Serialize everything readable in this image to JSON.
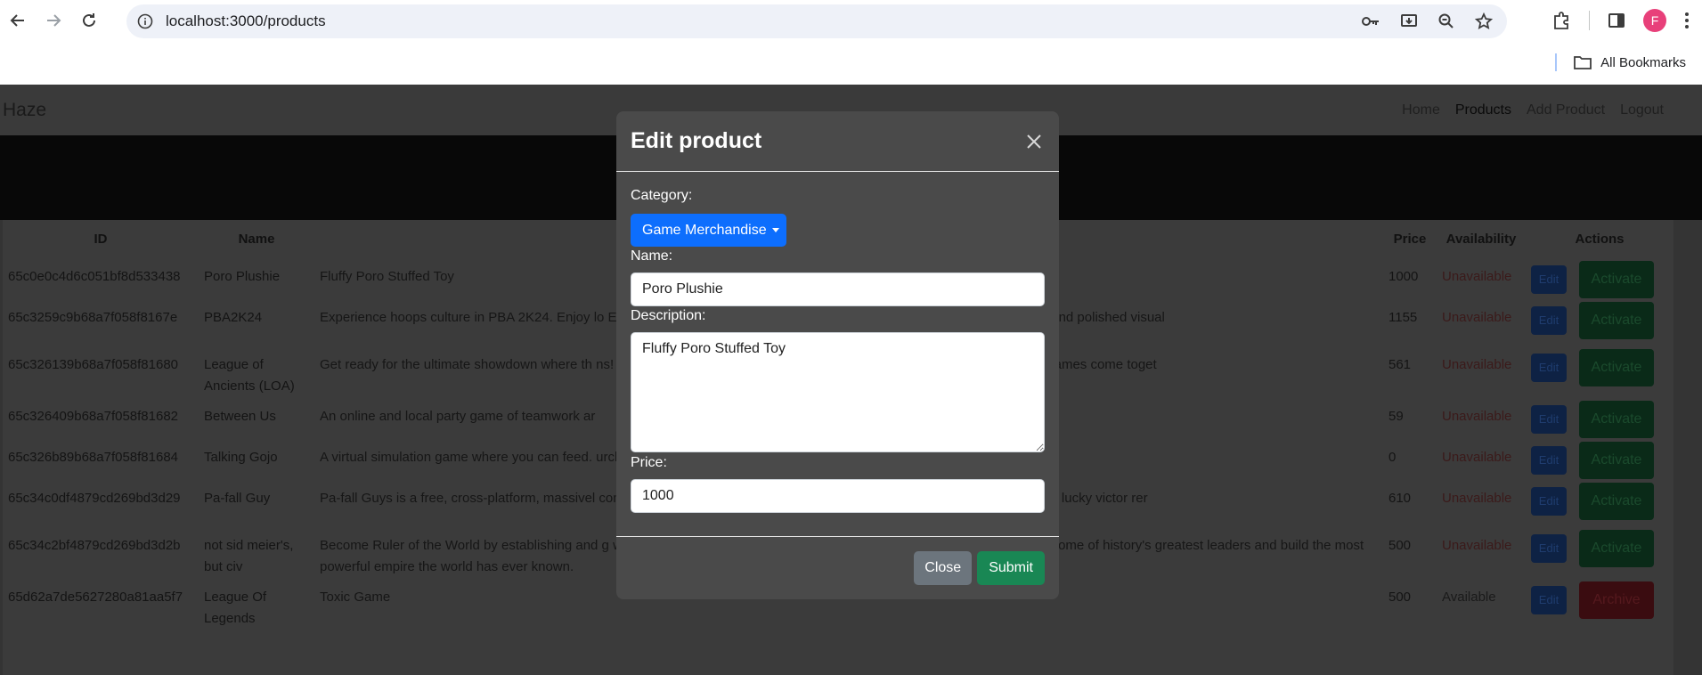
{
  "browser": {
    "url": "localhost:3000/products",
    "avatar_letter": "F",
    "bookmarks_label": "All Bookmarks"
  },
  "app": {
    "brand": "Haze",
    "nav": [
      "Home",
      "Products",
      "Add Product",
      "Logout"
    ],
    "active_nav": "Products"
  },
  "table": {
    "headers": [
      "ID",
      "Name",
      "",
      "Price",
      "Availability",
      "Actions"
    ],
    "rows": [
      {
        "id": "65c0e0c4d6c051bf8d533438",
        "name": "Poro Plushie",
        "desc": "Fluffy Poro Stuffed Toy",
        "price": "1000",
        "availability": "Unavailable",
        "edit": "Edit",
        "action": "Activate"
      },
      {
        "id": "65c3259c9b68a7f058f8167e",
        "name": "PBA2K24",
        "desc": "Experience hoops culture in PBA 2K24. Enjoy lo                                                                                     ER. Build your perfect lineup in MyTEAM. Feel more responsive gameplay and polished visual",
        "price": "1155",
        "availability": "Unavailable",
        "edit": "Edit",
        "action": "Activate"
      },
      {
        "id": "65c326139b68a7f058f81680",
        "name": "League of Ancients (LOA)",
        "desc": "Get ready for the ultimate showdown where th                                                                                    ns! Step into the arena and choose your side as iconic characters from both games come toget",
        "price": "561",
        "availability": "Unavailable",
        "edit": "Edit",
        "action": "Activate"
      },
      {
        "id": "65c326409b68a7f058f81682",
        "name": "Between Us",
        "desc": "An online and local party game of teamwork ar",
        "price": "59",
        "availability": "Unavailable",
        "edit": "Edit",
        "action": "Activate"
      },
      {
        "id": "65c326b89b68a7f058f81684",
        "name": "Talking Gojo",
        "desc": "A virtual simulation game where you can feed.                                                                                     urchases",
        "price": "0",
        "availability": "Unavailable",
        "edit": "Edit",
        "action": "Activate"
      },
      {
        "id": "65c34c0df4879cd269bd3d29",
        "name": "Pa-fall Guy",
        "desc": "Pa-fall Guys is a free, cross-platform, massivel                                                                                    compete through escalating rounds of absurd obstacle course chaos until one lucky victor rer",
        "price": "610",
        "availability": "Unavailable",
        "edit": "Edit",
        "action": "Activate"
      },
      {
        "id": "65c34c2bf4879cd269bd3d2b",
        "name": "not sid meier's, but civ",
        "desc": "Become Ruler of the World by establishing and                                                                                    g war, conduct diplomacy, discover new technologies, go head-to-head with some of history's greatest leaders and build the most powerful empire the world has ever known.",
        "price": "500",
        "availability": "Unavailable",
        "edit": "Edit",
        "action": "Activate"
      },
      {
        "id": "65d62a7de5627280a81aa5f7",
        "name": "League Of Legends",
        "desc": "Toxic Game",
        "price": "500",
        "availability": "Available",
        "edit": "Edit",
        "action": "Archive"
      }
    ]
  },
  "modal": {
    "title": "Edit product",
    "category_label": "Category:",
    "category_value": "Game Merchandise",
    "name_label": "Name:",
    "name_value": "Poro Plushie",
    "description_label": "Description:",
    "description_value": "Fluffy Poro Stuffed Toy",
    "price_label": "Price:",
    "price_value": "1000",
    "close_label": "Close",
    "submit_label": "Submit"
  },
  "colors": {
    "primary": "#0d6efd",
    "success": "#198754",
    "secondary": "#6c757d",
    "modal_bg": "#4a4a4a"
  }
}
